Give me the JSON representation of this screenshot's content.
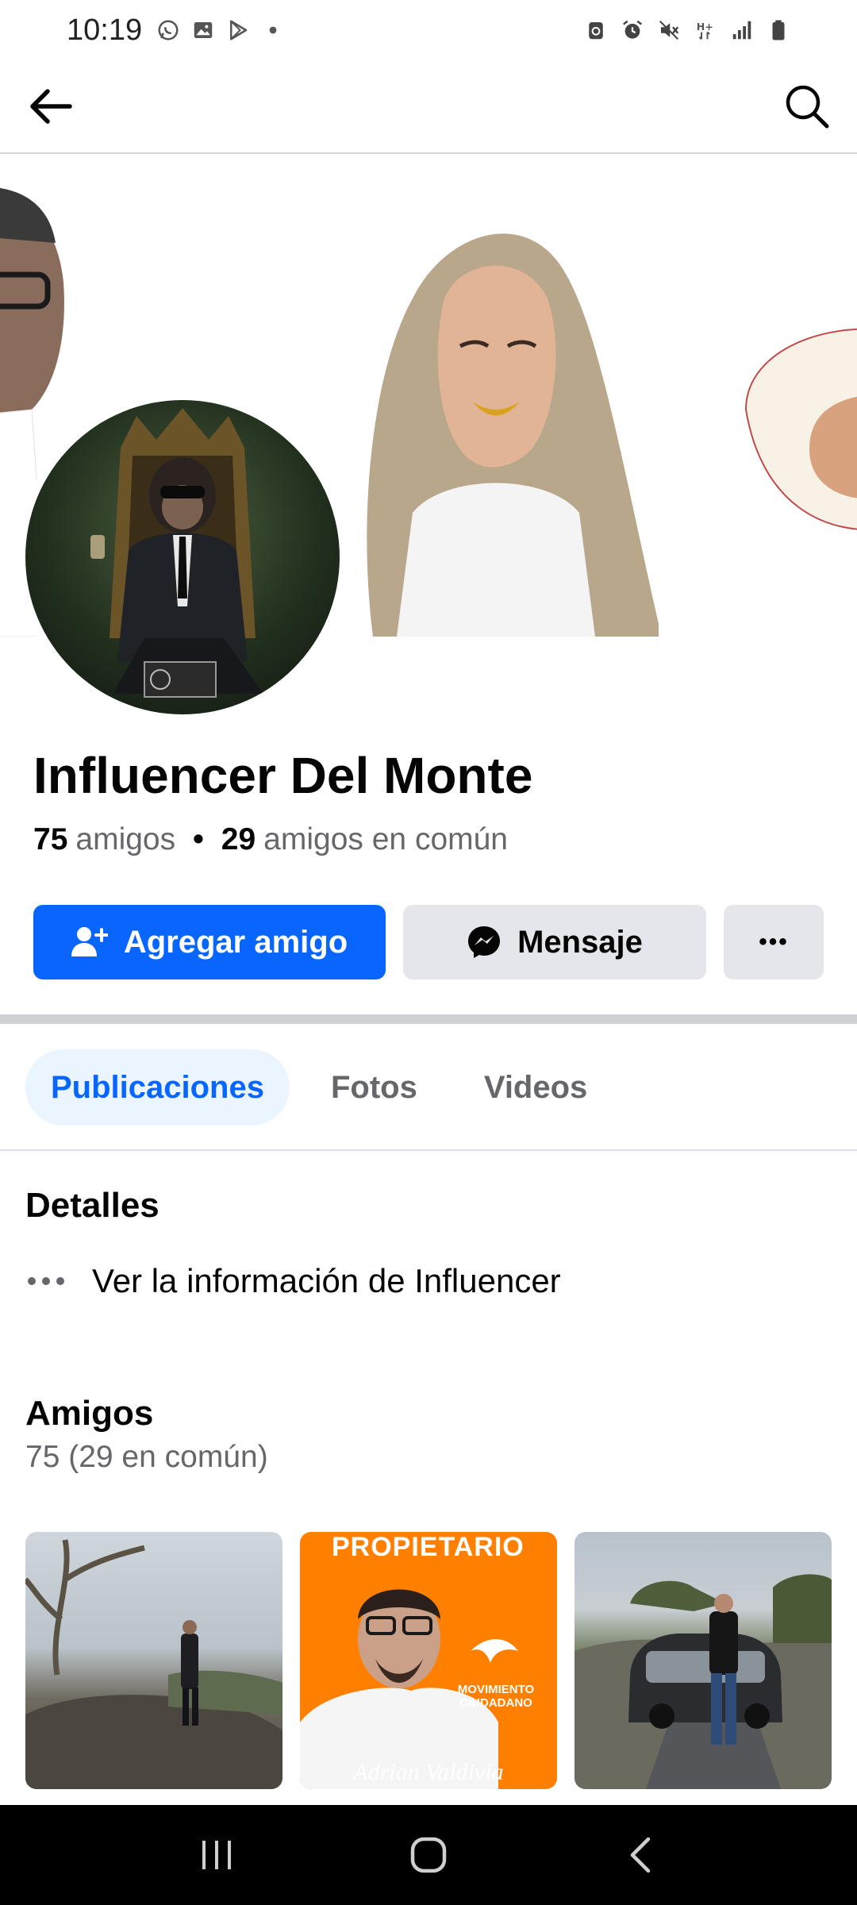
{
  "status_bar": {
    "time": "10:19",
    "left_icons": [
      "whatsapp-icon",
      "gallery-icon",
      "play-store-icon",
      "notification-dot-icon"
    ],
    "right_icons": [
      "recycle-icon",
      "alarm-icon",
      "mute-icon",
      "hplus-icon",
      "signal-icon",
      "battery-icon"
    ]
  },
  "app_bar": {
    "back_icon": "arrow-left-icon",
    "search_icon": "search-icon"
  },
  "profile": {
    "name": "Influencer Del Monte",
    "friends_count": "75",
    "friends_label": "amigos",
    "mutual_count": "29",
    "mutual_label": "amigos en común",
    "separator": "•"
  },
  "actions": {
    "add_friend_label": "Agregar amigo",
    "message_label": "Mensaje",
    "more_label": "•••"
  },
  "tabs": [
    {
      "label": "Publicaciones",
      "active": true
    },
    {
      "label": "Fotos",
      "active": false
    },
    {
      "label": "Videos",
      "active": false
    }
  ],
  "details": {
    "title": "Detalles",
    "info_link": "Ver la información de Influencer",
    "dots": "•••"
  },
  "friends": {
    "title": "Amigos",
    "subtitle": "75 (29 en común)",
    "poster_top": "PROPIETARIO",
    "poster_brand": "MOVIMIENTO CIUDADANO",
    "poster_name": "Adrian Valdivia"
  },
  "colors": {
    "primary_blue": "#0866ff",
    "secondary_gray": "#e4e6eb",
    "text_secondary": "#65676b",
    "mc_orange": "#ff7f00"
  }
}
